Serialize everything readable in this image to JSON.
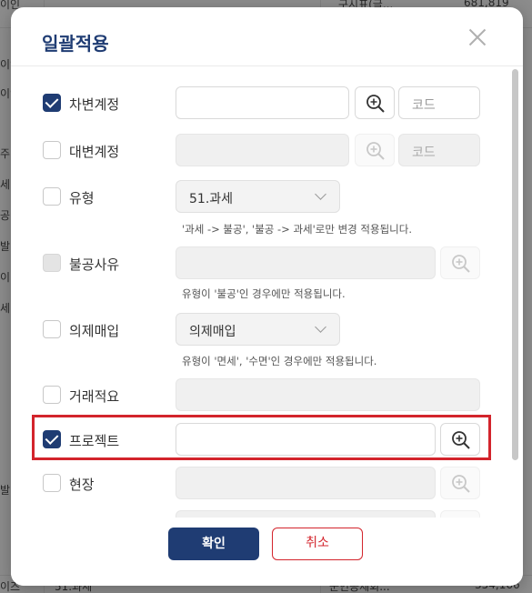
{
  "background": {
    "left_fragments": [
      "이인",
      "이인",
      "이인",
      "주",
      "세",
      "공",
      "발",
      "이",
      "세",
      "",
      "",
      "",
      "",
      "",
      "발",
      "",
      "",
      "",
      "",
      "",
      "",
      "",
      "이즈"
    ],
    "top_cells": [
      "구시표(글...",
      "681,819"
    ],
    "bottom_cells": [
      "51.과세",
      "군인공제회...",
      "354,166"
    ]
  },
  "modal": {
    "title": "일괄적용",
    "close_label": "×",
    "rows": [
      {
        "label": "차변계정",
        "checked": true,
        "code_placeholder": "코드"
      },
      {
        "label": "대변계정",
        "checked": false,
        "code_placeholder": "코드"
      },
      {
        "label": "유형",
        "checked": false,
        "select_value": "51.과세",
        "hint": "'과세 -> 불공', '불공 -> 과세'로만 변경 적용됩니다."
      },
      {
        "label": "불공사유",
        "checked": false,
        "disabled": true,
        "hint": "유형이 '불공'인 경우에만 적용됩니다."
      },
      {
        "label": "의제매입",
        "checked": false,
        "select_value": "의제매입",
        "hint": "유형이 '면세', '수면'인 경우에만 적용됩니다."
      },
      {
        "label": "거래적요",
        "checked": false
      },
      {
        "label": "프로젝트",
        "checked": true
      },
      {
        "label": "현장",
        "checked": false
      }
    ],
    "footer": {
      "ok_label": "확인",
      "cancel_label": "취소"
    }
  },
  "colors": {
    "primary": "#1f3c73",
    "highlight": "#d3242c"
  }
}
